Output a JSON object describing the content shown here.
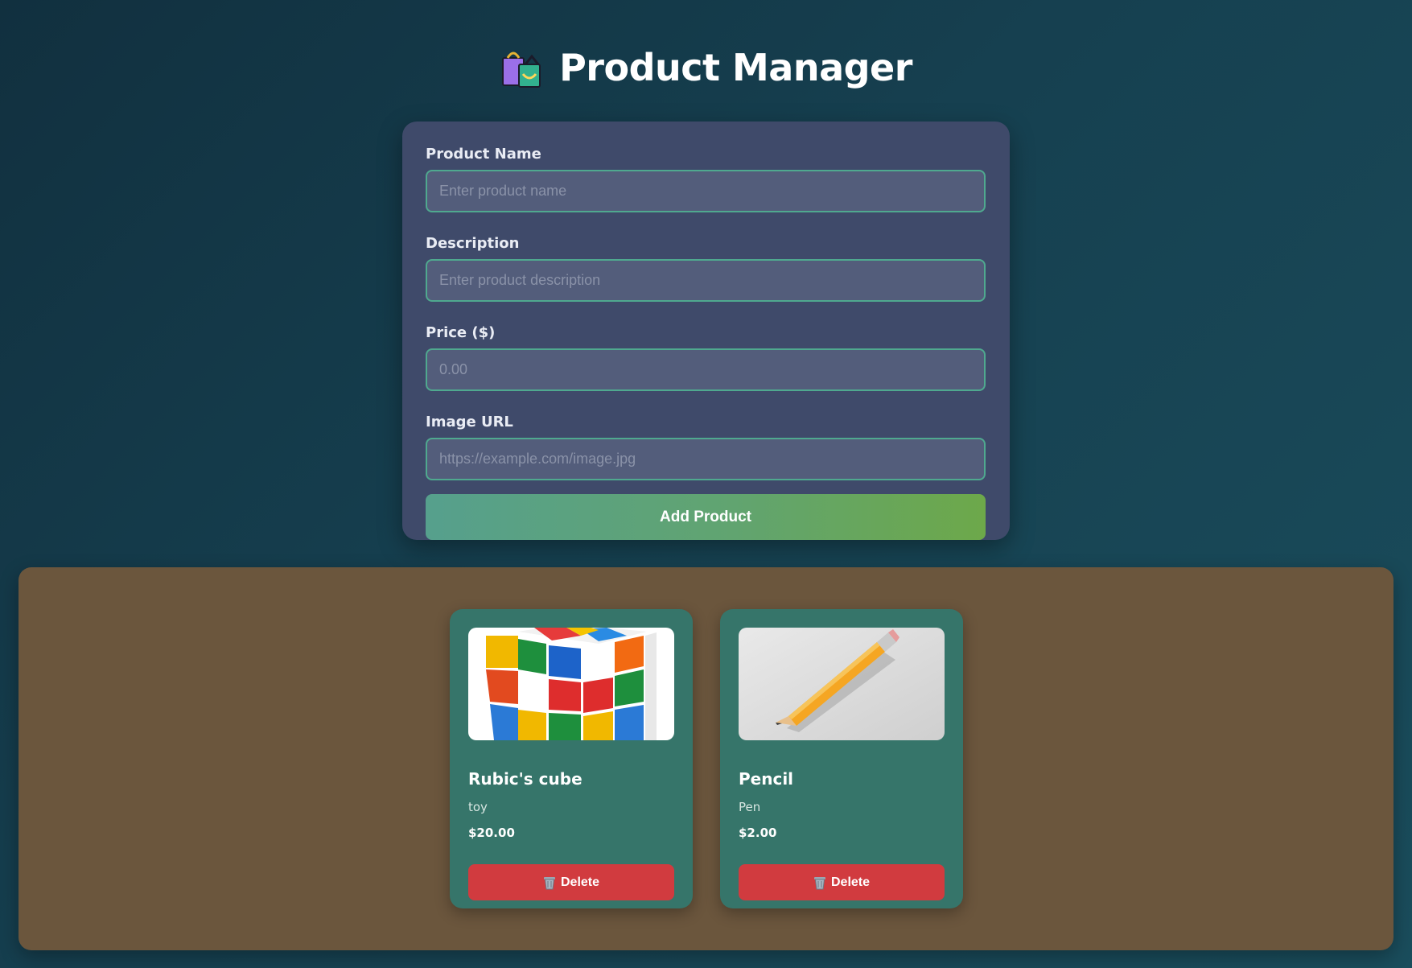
{
  "header": {
    "title": "Product Manager",
    "icon": "shopping-bags-icon"
  },
  "form": {
    "fields": [
      {
        "label": "Product Name",
        "placeholder": "Enter product name",
        "value": ""
      },
      {
        "label": "Description",
        "placeholder": "Enter product description",
        "value": ""
      },
      {
        "label": "Price ($)",
        "placeholder": "0.00",
        "value": ""
      },
      {
        "label": "Image URL",
        "placeholder": "https://example.com/image.jpg",
        "value": ""
      }
    ],
    "submit_label": "Add Product"
  },
  "products": [
    {
      "name": "Rubic's cube",
      "description": "toy",
      "price": "$20.00",
      "image": "rubiks-cube-photo",
      "delete_label": "Delete"
    },
    {
      "name": "Pencil",
      "description": "Pen",
      "price": "$2.00",
      "image": "pencil-photo",
      "delete_label": "Delete"
    }
  ],
  "colors": {
    "form_bg": "#3f4a6a",
    "input_border": "#4fa98f",
    "list_bg": "#6b563d",
    "card_bg": "#36756a",
    "delete_bg": "#d13b3f"
  }
}
